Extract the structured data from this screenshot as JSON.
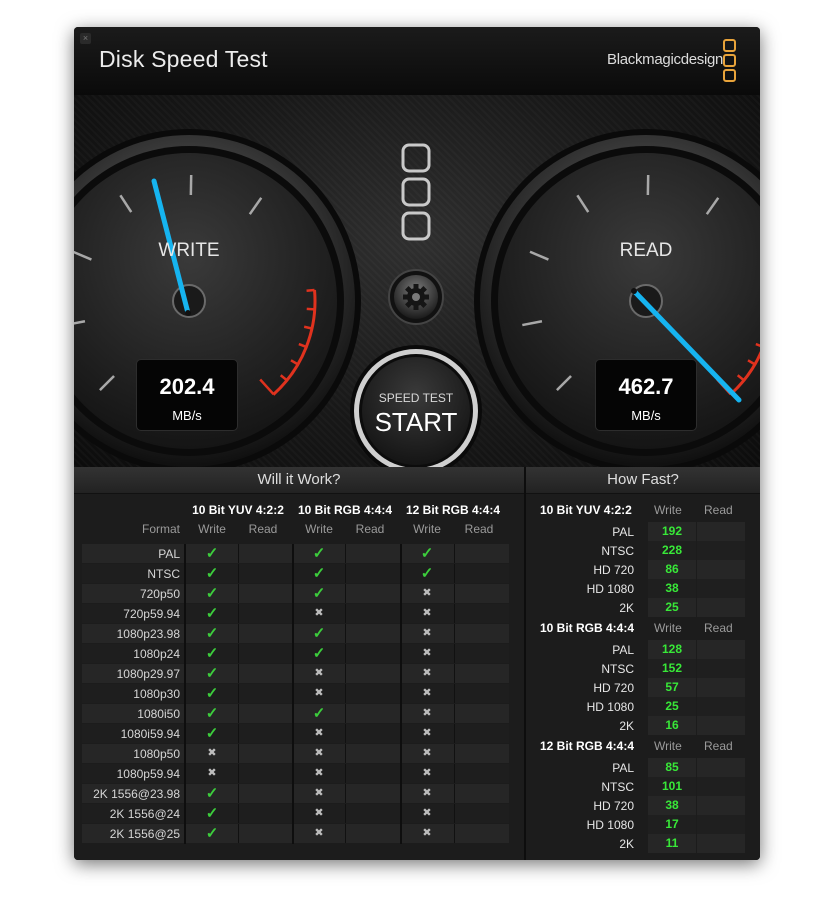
{
  "window": {
    "title": "Disk Speed Test",
    "brand": "Blackmagicdesign",
    "close_glyph": "×"
  },
  "gauges": {
    "write": {
      "label": "WRITE",
      "value": "202.4",
      "unit": "MB/s"
    },
    "read": {
      "label": "READ",
      "value": "462.7",
      "unit": "MB/s"
    }
  },
  "controls": {
    "settings_icon": "gear-icon",
    "start_top": "SPEED TEST",
    "start_main": "START"
  },
  "will_it_work": {
    "title": "Will it Work?",
    "format_header": "Format",
    "groups": [
      {
        "name": "10 Bit YUV 4:2:2",
        "write": "Write",
        "read": "Read"
      },
      {
        "name": "10 Bit RGB 4:4:4",
        "write": "Write",
        "read": "Read"
      },
      {
        "name": "12 Bit RGB 4:4:4",
        "write": "Write",
        "read": "Read"
      }
    ],
    "rows": [
      {
        "format": "PAL",
        "marks": [
          "ok",
          "ok",
          "ok"
        ]
      },
      {
        "format": "NTSC",
        "marks": [
          "ok",
          "ok",
          "ok"
        ]
      },
      {
        "format": "720p50",
        "marks": [
          "ok",
          "ok",
          "no"
        ]
      },
      {
        "format": "720p59.94",
        "marks": [
          "ok",
          "no",
          "no"
        ]
      },
      {
        "format": "1080p23.98",
        "marks": [
          "ok",
          "ok",
          "no"
        ]
      },
      {
        "format": "1080p24",
        "marks": [
          "ok",
          "ok",
          "no"
        ]
      },
      {
        "format": "1080p29.97",
        "marks": [
          "ok",
          "no",
          "no"
        ]
      },
      {
        "format": "1080p30",
        "marks": [
          "ok",
          "no",
          "no"
        ]
      },
      {
        "format": "1080i50",
        "marks": [
          "ok",
          "ok",
          "no"
        ]
      },
      {
        "format": "1080i59.94",
        "marks": [
          "ok",
          "no",
          "no"
        ]
      },
      {
        "format": "1080p50",
        "marks": [
          "no",
          "no",
          "no"
        ]
      },
      {
        "format": "1080p59.94",
        "marks": [
          "no",
          "no",
          "no"
        ]
      },
      {
        "format": "2K 1556@23.98",
        "marks": [
          "ok",
          "no",
          "no"
        ]
      },
      {
        "format": "2K 1556@24",
        "marks": [
          "ok",
          "no",
          "no"
        ]
      },
      {
        "format": "2K 1556@25",
        "marks": [
          "ok",
          "no",
          "no"
        ]
      }
    ],
    "check_glyph": "✓",
    "cross_glyph": "✖"
  },
  "how_fast": {
    "title": "How Fast?",
    "groups": [
      {
        "name": "10 Bit YUV 4:2:2",
        "write": "Write",
        "read": "Read",
        "rows": [
          {
            "label": "PAL",
            "write": "192"
          },
          {
            "label": "NTSC",
            "write": "228"
          },
          {
            "label": "HD 720",
            "write": "86"
          },
          {
            "label": "HD 1080",
            "write": "38"
          },
          {
            "label": "2K",
            "write": "25"
          }
        ]
      },
      {
        "name": "10 Bit RGB 4:4:4",
        "write": "Write",
        "read": "Read",
        "rows": [
          {
            "label": "PAL",
            "write": "128"
          },
          {
            "label": "NTSC",
            "write": "152"
          },
          {
            "label": "HD 720",
            "write": "57"
          },
          {
            "label": "HD 1080",
            "write": "25"
          },
          {
            "label": "2K",
            "write": "16"
          }
        ]
      },
      {
        "name": "12 Bit RGB 4:4:4",
        "write": "Write",
        "read": "Read",
        "rows": [
          {
            "label": "PAL",
            "write": "85"
          },
          {
            "label": "NTSC",
            "write": "101"
          },
          {
            "label": "HD 720",
            "write": "38"
          },
          {
            "label": "HD 1080",
            "write": "17"
          },
          {
            "label": "2K",
            "write": "11"
          }
        ]
      }
    ]
  },
  "colors": {
    "accent_needle": "#16b4f0",
    "redline": "#e0321e",
    "ok": "#3ccd3c",
    "value_green": "#38e838",
    "brand_orange": "#e8a33a"
  }
}
